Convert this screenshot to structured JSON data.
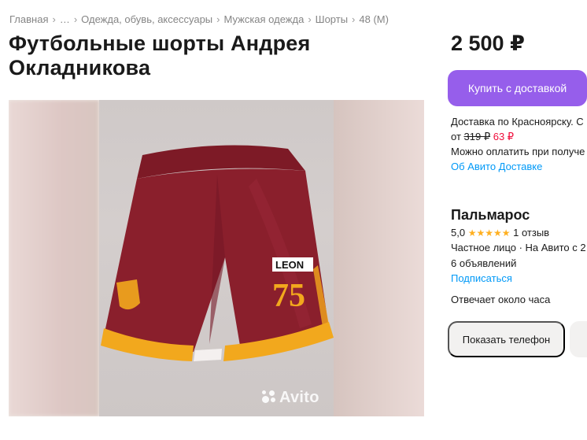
{
  "breadcrumb": {
    "items": [
      "Главная",
      "…",
      "Одежда, обувь, аксессуары",
      "Мужская одежда",
      "Шорты",
      "48 (M)"
    ]
  },
  "listing": {
    "title": "Футбольные шорты Андрея Окладникова",
    "price": "2 500 ₽",
    "watermark": "Avito",
    "shorts_text": {
      "brand": "LEON",
      "number": "75"
    }
  },
  "purchase": {
    "buy_label": "Купить с доставкой",
    "delivery_line": "Доставка по Красноярску. С",
    "delivery_from": "от",
    "old_price": "319 ₽",
    "new_price": "63 ₽",
    "payment_line": "Можно оплатить при получе",
    "delivery_link": "Об Авито Доставке"
  },
  "seller": {
    "name": "Пальмарос",
    "rating": "5,0",
    "stars": "★★★★★",
    "reviews": "1 отзыв",
    "type_line": "Частное лицо · На Авито с 2",
    "ads_count": "6 объявлений",
    "subscribe": "Подписаться",
    "response": "Отвечает около часа",
    "phone_label": "Показать телефон"
  },
  "colors": {
    "accent": "#965eeb",
    "link": "#0099f7",
    "discount": "#f00d3b",
    "star": "#ffb021",
    "shorts_main": "#8a1f2c",
    "shorts_trim": "#f2a81d"
  }
}
